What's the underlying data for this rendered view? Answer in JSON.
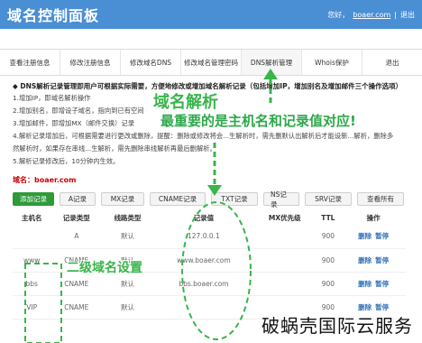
{
  "header": {
    "title": "域名控制面板",
    "greeting": "您好，",
    "domain": "boaer.com",
    "divider": "|",
    "exit": "退出"
  },
  "nav": [
    "查看注册信息",
    "修改注册信息",
    "修改域名DNS",
    "修改域名管理密码",
    "DNS解析管理",
    "Whois保护",
    "退出"
  ],
  "notice": {
    "title": "◆ DNS解析记录管理即用户可根据实际需要，方便地修改或增加域名解析记录（包括增加IP，增加别名及增加邮件三个操作选项）",
    "items": [
      "1.增加IP，即域名解析操作",
      "2.增加别名，即增设子域名，指向到已有空间",
      "3.增加邮件，即增加MX（邮件交换）记录",
      "4.解析记录增加后，可根据需要进行更改或删除，提醒：删除或修改将会...生解析时，需先删默认出解析后才能设新...解析，删除多",
      "然解析时，如果存在串线...生解析，需先删除串线解析再最后删解析。",
      "5.解析记录修改后，10分钟内生效。"
    ]
  },
  "domain_line": {
    "label": "域名：",
    "value": "boaer.com"
  },
  "toolbar": [
    "添加记录",
    "A记录",
    "MX记录",
    "CNAME记录",
    "TXT记录",
    "NS记录",
    "SRV记录",
    "查看所有"
  ],
  "table": {
    "headers": [
      "主机名",
      "记录类型",
      "线路类型",
      "记录值",
      "MX优先级",
      "TTL",
      "操作"
    ],
    "rows": [
      {
        "host": "",
        "type": "A",
        "line": "默认",
        "value": "127.0.0.1",
        "mx": "",
        "ttl": "900",
        "actions": [
          "删除",
          "暂停"
        ]
      },
      {
        "host": "www",
        "type": "CNAME",
        "line": "默认",
        "value": "www.boaer.com",
        "mx": "",
        "ttl": "900",
        "actions": [
          "删除",
          "暂停"
        ]
      },
      {
        "host": "bbs",
        "type": "CNAME",
        "line": "默认",
        "value": "bbs.boaer.com",
        "mx": "",
        "ttl": "900",
        "actions": [
          "删除",
          "暂停"
        ]
      },
      {
        "host": "VIP",
        "type": "CNAME",
        "line": "默认",
        "value": "",
        "mx": "",
        "ttl": "900",
        "actions": [
          "删除",
          "暂停"
        ]
      }
    ]
  },
  "annotations": {
    "big_l1": "域名解析",
    "big_l2": "最重要的是主机名和记录值对应!",
    "small": "二级域名设置",
    "watermark": "破蜗壳国际云服务",
    "color": "#39b54a"
  }
}
